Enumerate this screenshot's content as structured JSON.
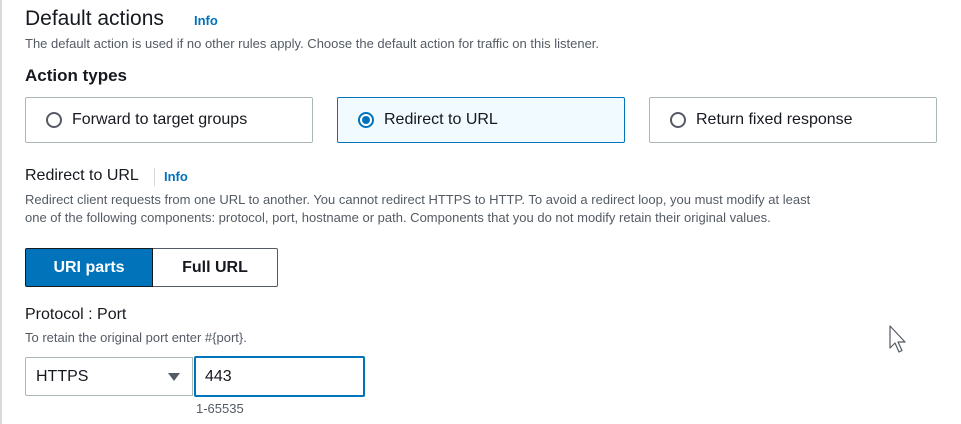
{
  "default_actions": {
    "title": "Default actions",
    "info": "Info",
    "description": "The default action is used if no other rules apply. Choose the default action for traffic on this listener."
  },
  "action_types": {
    "title": "Action types",
    "options": [
      {
        "label": "Forward to target groups",
        "selected": false
      },
      {
        "label": "Redirect to URL",
        "selected": true
      },
      {
        "label": "Return fixed response",
        "selected": false
      }
    ]
  },
  "redirect": {
    "title": "Redirect to URL",
    "info": "Info",
    "description_line1": "Redirect client requests from one URL to another. You cannot redirect HTTPS to HTTP. To avoid a redirect loop, you must modify at least",
    "description_line2": "one of the following components: protocol, port, hostname or path. Components that you do not modify retain their original values.",
    "modes": {
      "uri_parts": "URI parts",
      "full_url": "Full URL",
      "selected": "URI parts"
    },
    "protocol_port": {
      "label": "Protocol : Port",
      "hint": "To retain the original port enter #{port}.",
      "protocol_value": "HTTPS",
      "port_value": "443",
      "port_constraint": "1-65535"
    }
  },
  "colors": {
    "accent": "#0073bb",
    "selected_tile_bg": "#f1faff",
    "text": "#16191f",
    "muted": "#545b64"
  },
  "icons": {
    "cursor": "mouse-pointer-icon",
    "dropdown": "caret-down-icon"
  }
}
